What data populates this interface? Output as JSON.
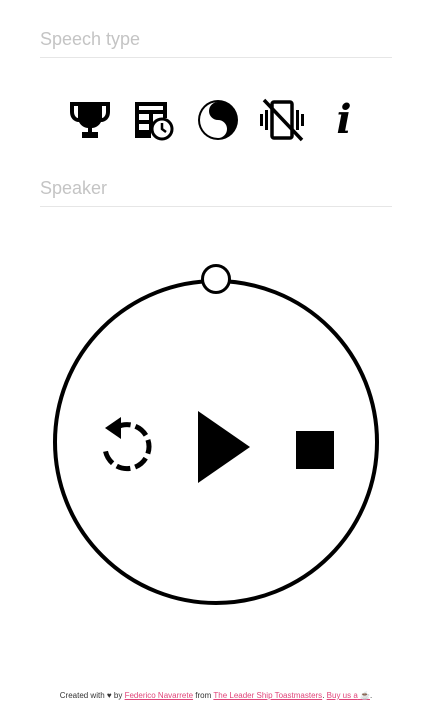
{
  "speech_type": {
    "placeholder": "Speech type",
    "value": ""
  },
  "speaker": {
    "placeholder": "Speaker",
    "value": ""
  },
  "icons": [
    {
      "name": "trophy-icon"
    },
    {
      "name": "table-clock-icon"
    },
    {
      "name": "yin-yang-icon"
    },
    {
      "name": "vibrate-off-icon"
    },
    {
      "name": "info-icon",
      "glyph": "i"
    }
  ],
  "timer": {
    "progress": 0
  },
  "footer": {
    "created_with": "Created with",
    "heart": "♥",
    "by": "by",
    "author": "Federico Navarrete",
    "from": "from",
    "club": "The Leader Ship Toastmasters",
    "sep": ".",
    "buy": "Buy us a",
    "cup": "☕",
    "end": "."
  }
}
